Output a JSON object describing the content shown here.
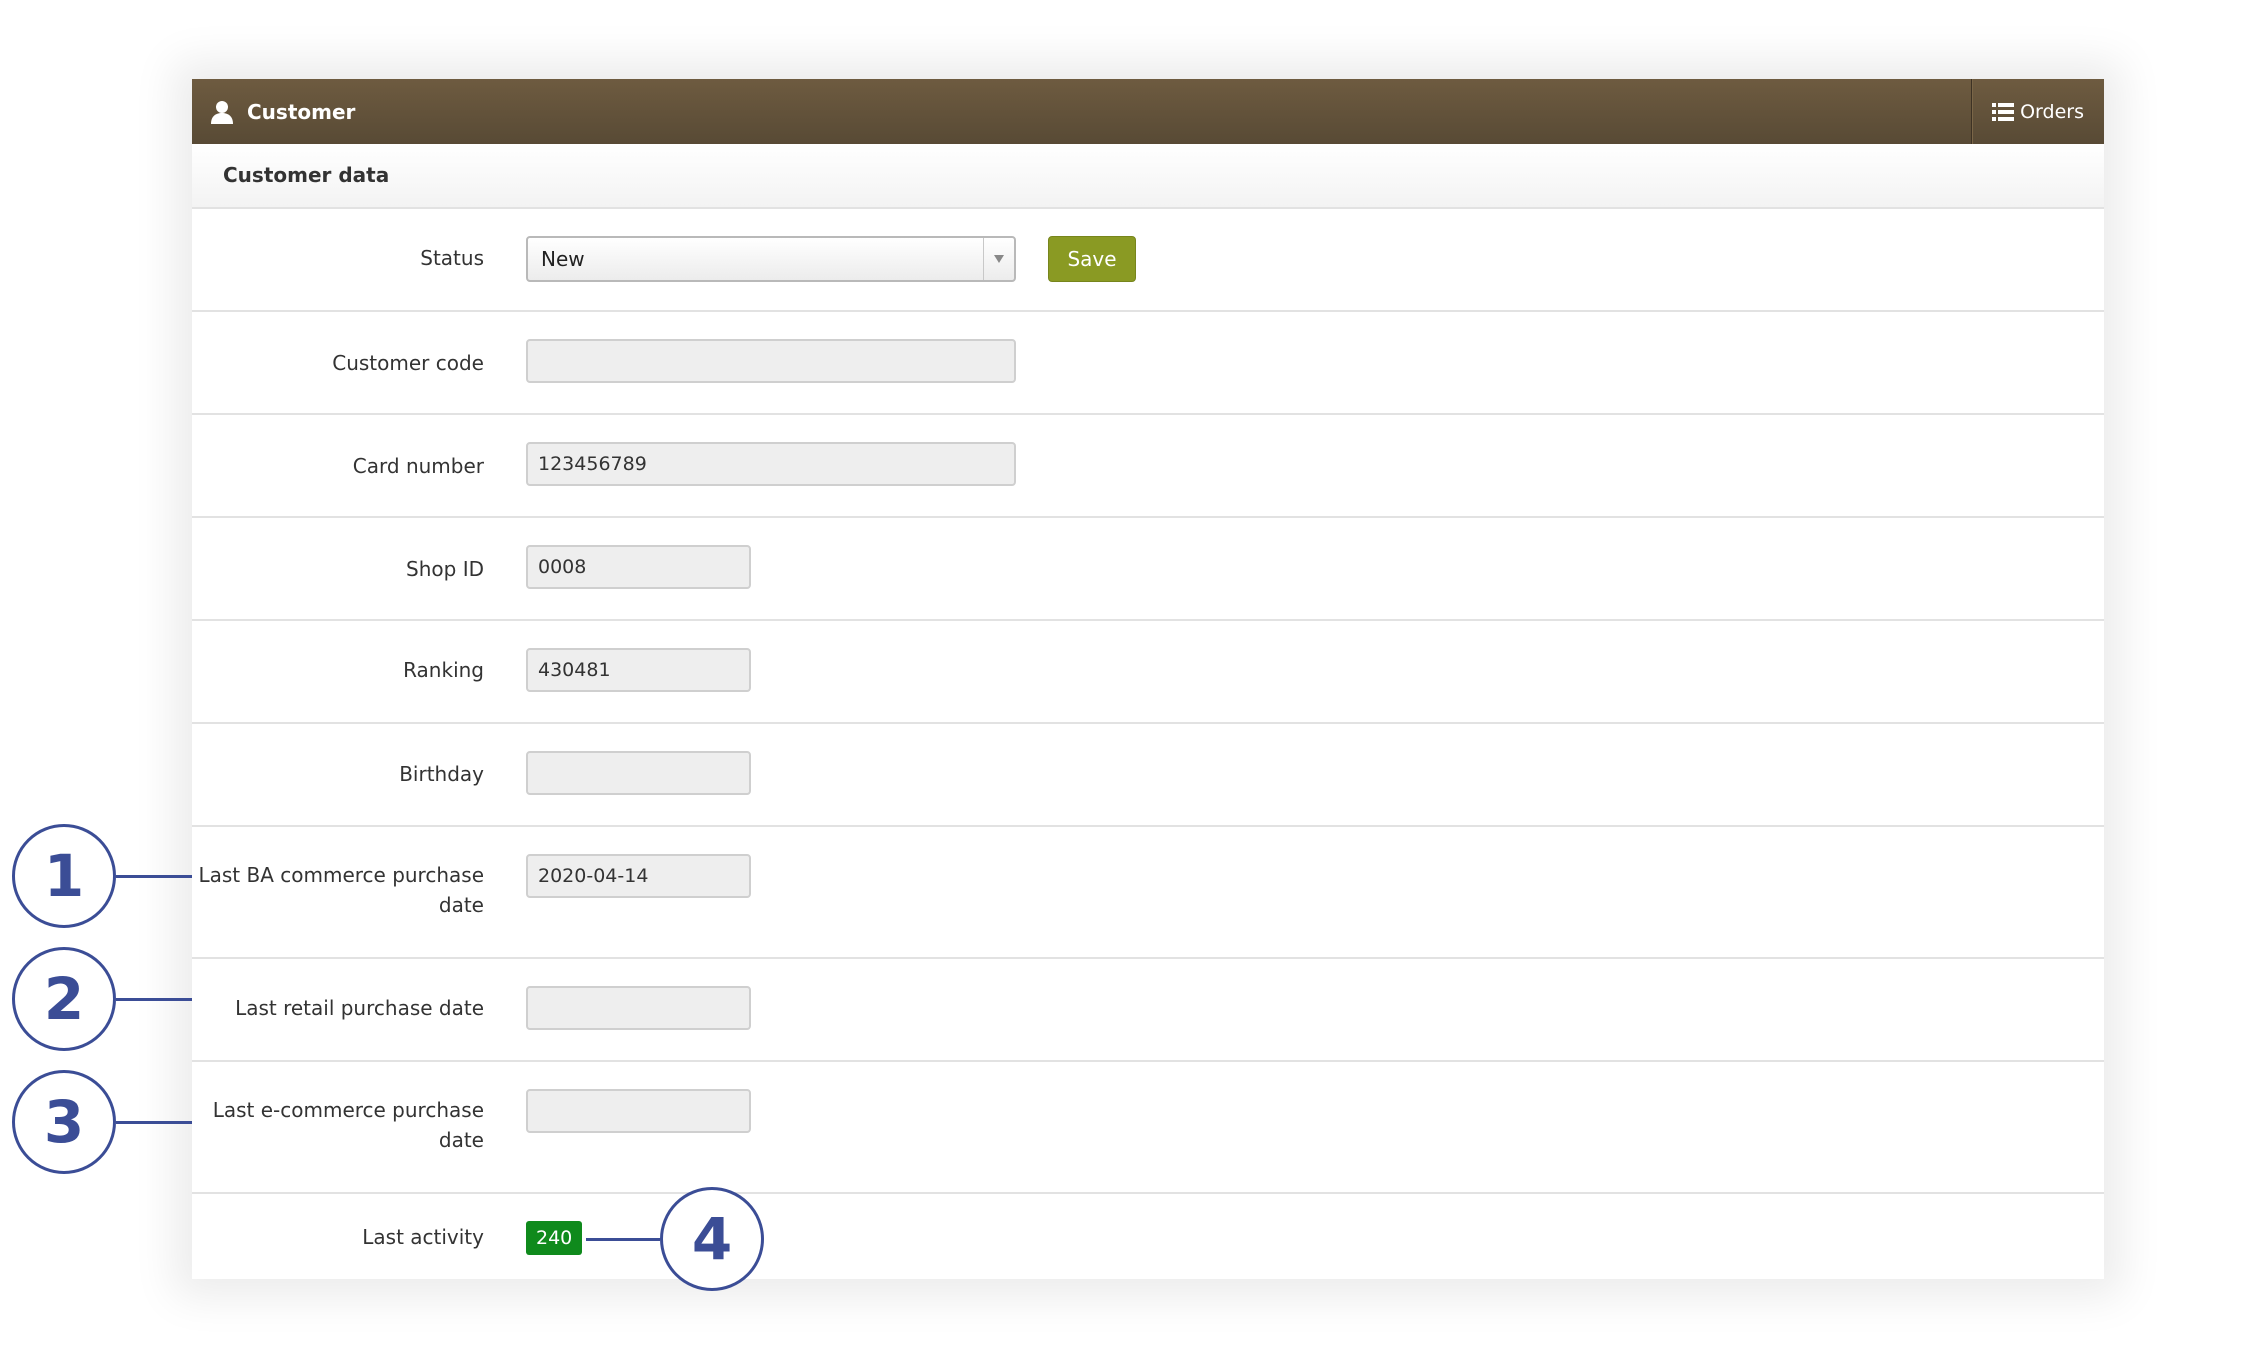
{
  "header": {
    "title": "Customer",
    "orders_label": "Orders"
  },
  "section_title": "Customer data",
  "status": {
    "label": "Status",
    "value": "New",
    "save_label": "Save"
  },
  "fields": {
    "customer_code": {
      "label": "Customer code",
      "value": ""
    },
    "card_number": {
      "label": "Card number",
      "value": "123456789"
    },
    "shop_id": {
      "label": "Shop ID",
      "value": "0008"
    },
    "ranking": {
      "label": "Ranking",
      "value": "430481"
    },
    "birthday": {
      "label": "Birthday",
      "value": ""
    },
    "last_ba": {
      "label_line1": "Last BA commerce purchase",
      "label_line2": "date",
      "value": "2020-04-14"
    },
    "last_retail": {
      "label": "Last retail purchase date",
      "value": ""
    },
    "last_ecom": {
      "label_line1": "Last e-commerce purchase",
      "label_line2": "date",
      "value": ""
    },
    "last_activity": {
      "label": "Last activity",
      "value": "240"
    }
  },
  "callouts": [
    "1",
    "2",
    "3",
    "4"
  ],
  "colors": {
    "header": "#5f4f39",
    "save": "#8a9a23",
    "badge": "#0f8a1c",
    "callout": "#3b4d96"
  },
  "icons": {
    "header": "user-icon",
    "orders": "list-icon",
    "select": "caret-down-icon"
  }
}
